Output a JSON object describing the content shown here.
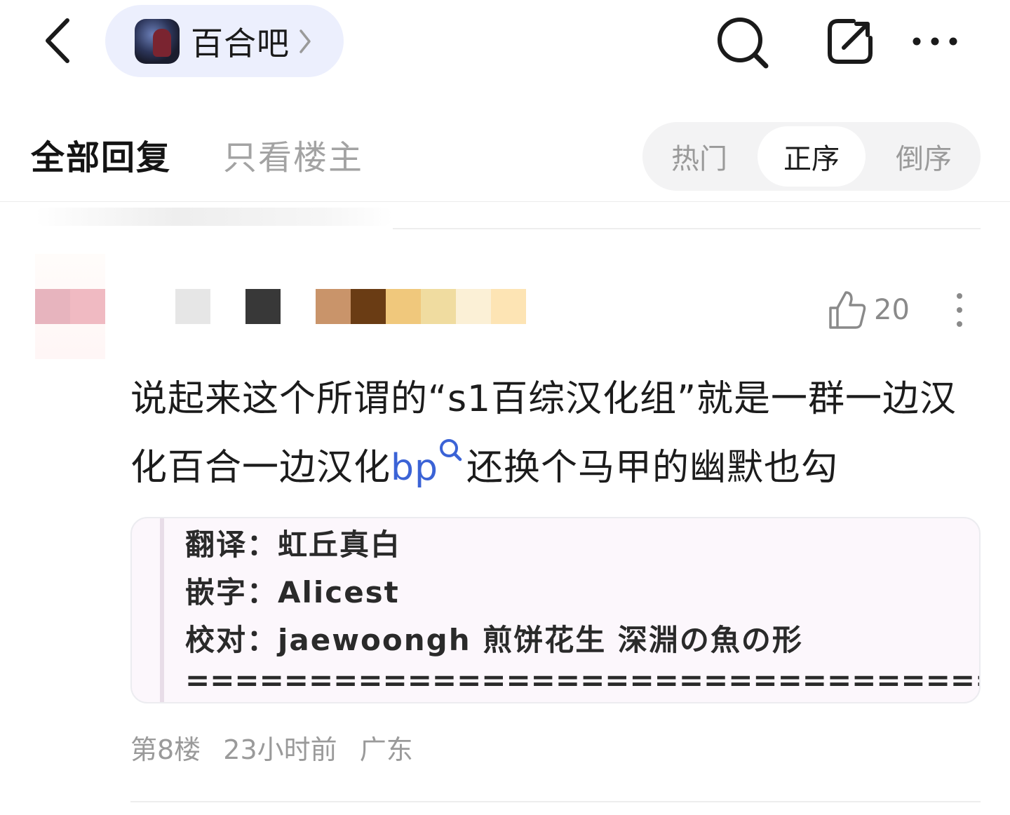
{
  "header": {
    "back_icon": "chevron-left-icon",
    "forum_name": "百合吧",
    "search_icon": "search-icon",
    "edit_icon": "edit-icon",
    "more_icon": "more-horizontal-icon"
  },
  "tabs": {
    "all_replies": "全部回复",
    "op_only": "只看楼主",
    "sort": {
      "hot": "热门",
      "ascending": "正序",
      "descending": "倒序",
      "selected": "正序"
    }
  },
  "post": {
    "like_count": "20",
    "text_part1": "说起来这个所谓的“s1百综汉化组”就是一群一边汉化百合一边汉化",
    "tag_link": "bp",
    "text_part2": "还换个马甲的幽默也勾",
    "image_lines": [
      "翻译：虹丘真白",
      "嵌字：Alicest",
      "校对：jaewoongh 煎饼花生 深淵の魚の形",
      "======================================="
    ],
    "meta": {
      "floor": "第8楼",
      "time": "23小时前",
      "location": "广东"
    }
  },
  "colors": {
    "accent_link": "#3b63d6",
    "forum_pill_bg": "#eceffd"
  }
}
